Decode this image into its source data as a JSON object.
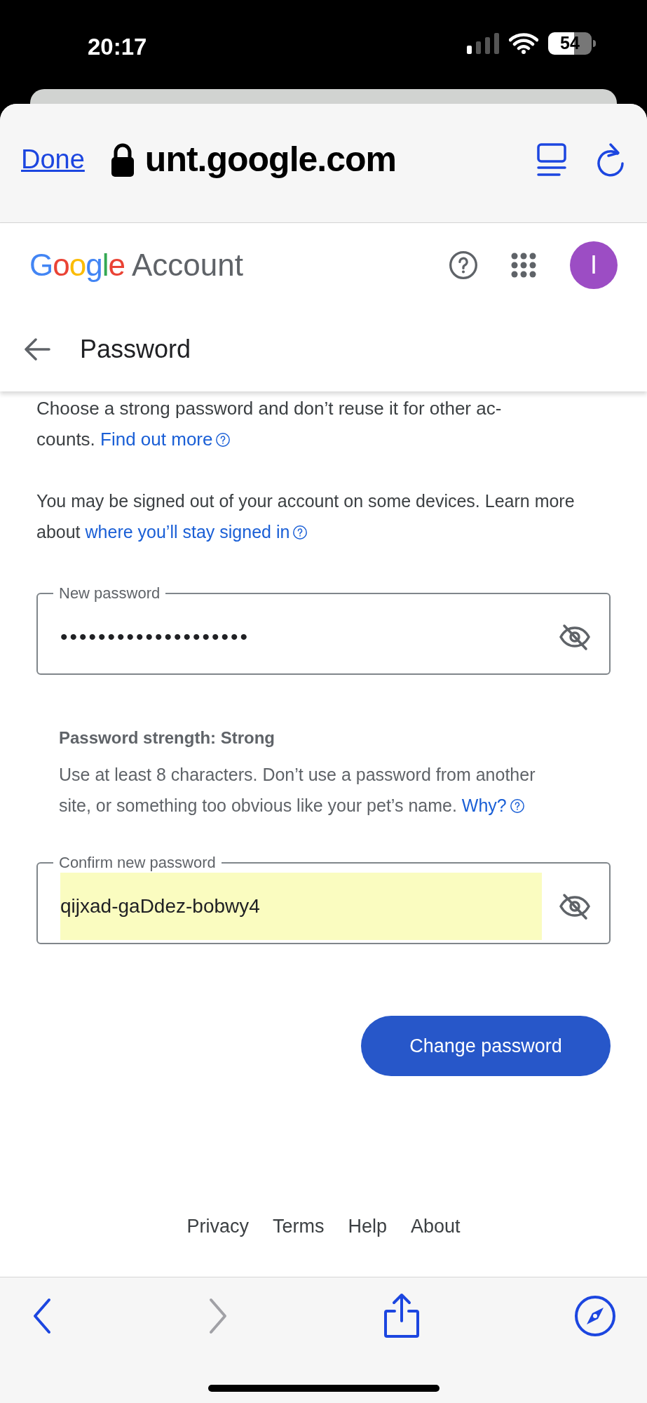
{
  "status_bar": {
    "time": "20:17",
    "battery": "54"
  },
  "browser": {
    "done": "Done",
    "url": "unt.google.com"
  },
  "header": {
    "logo": "Google",
    "product": "Account",
    "avatar": "I",
    "page_title": "Password"
  },
  "intro": {
    "lines": [
      "Choose a strong password and don’t reuse it for other ac-",
      "counts."
    ],
    "link": "Find out more"
  },
  "notice": {
    "text": "You may be signed out of your account on some devices. Learn more about",
    "link": "where you’ll stay signed in"
  },
  "fields": [
    {
      "label": "New password",
      "value": "••••••••••••••••••••",
      "autofilled": false
    },
    {
      "label": "Confirm new password",
      "value": "qijxad-gaDdez-bobwy4",
      "autofilled": true
    }
  ],
  "strength": {
    "title": "Password strength: Strong",
    "text": "Use at least 8 characters. Don’t use a password from another site, or something too obvious like your pet’s name.",
    "link": "Why?"
  },
  "submit": "Change password",
  "footer": [
    "Privacy",
    "Terms",
    "Help",
    "About"
  ],
  "toolbar": [
    {
      "kind": "back",
      "disabled": false
    },
    {
      "kind": "forward",
      "disabled": true
    },
    {
      "kind": "share",
      "disabled": false
    },
    {
      "kind": "compass",
      "disabled": false
    }
  ]
}
